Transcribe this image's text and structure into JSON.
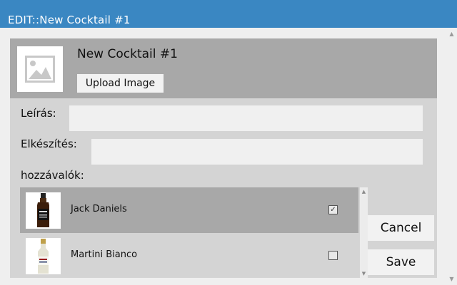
{
  "window": {
    "title": "EDIT::New Cocktail #1"
  },
  "header": {
    "image_icon": "image-placeholder-icon",
    "cocktail_name": "New Cocktail #1",
    "upload_label": "Upload Image"
  },
  "form": {
    "description_label": "Leírás:",
    "description_value": "",
    "preparation_label": "Elkészítés:",
    "preparation_value": "",
    "ingredients_label": "hozzávalók:"
  },
  "ingredients": [
    {
      "name": "Jack Daniels",
      "checked": true,
      "selected": true,
      "thumb_icon": "whiskey-bottle-icon"
    },
    {
      "name": "Martini Bianco",
      "checked": false,
      "selected": false,
      "thumb_icon": "vermouth-bottle-icon"
    }
  ],
  "actions": {
    "cancel_label": "Cancel",
    "save_label": "Save"
  },
  "colors": {
    "titlebar": "#3a87c2",
    "header_bg": "#a8a8a8",
    "panel_bg": "#d4d4d4",
    "selected_row": "#a8a8a8",
    "field_bg": "#f0f0f0"
  }
}
